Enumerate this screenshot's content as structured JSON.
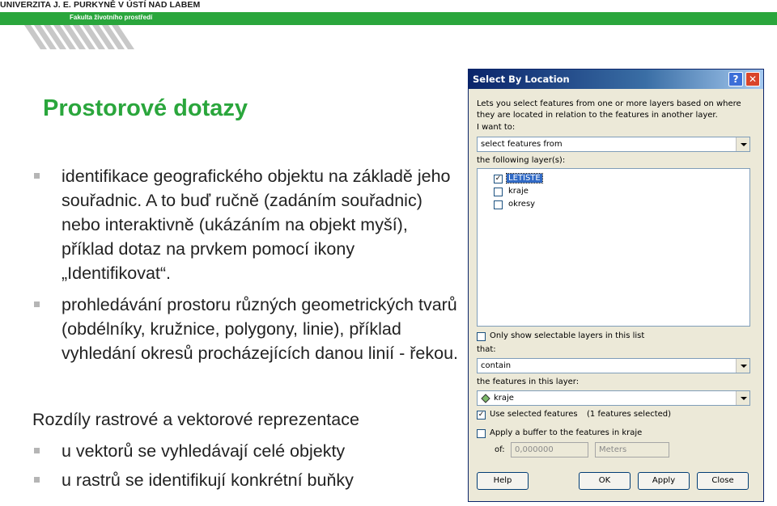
{
  "header": {
    "university": "UNIVERZITA J. E. PURKYNĚ V ÚSTÍ NAD LABEM",
    "faculty": "Fakulta životního prostředí"
  },
  "slide": {
    "title": "Prostorové dotazy",
    "bullets": [
      "identifikace geografického objektu na základě jeho souřadnic. A to buď ručně (zadáním souřadnic) nebo interaktivně (ukázáním na objekt myší), příklad dotaz na prvkem pomocí ikony „Identifikovat“.",
      "prohledávání prostoru různých geometrických tvarů (obdélníky, kružnice, polygony, linie), příklad vyhledání okresů procházejících danou linií - řekou."
    ],
    "subheading": "Rozdíly rastrové a vektorové reprezentace",
    "sub_bullets": [
      "u vektorů se vyhledávají celé objekty",
      "u rastrů se identifikují konkrétní buňky"
    ]
  },
  "dialog": {
    "title": "Select By Location",
    "help_glyph": "?",
    "close_glyph": "✕",
    "description": "Lets you select features from one or more layers based on where they are located in relation to the features in another layer.",
    "i_want_to_label": "I want to:",
    "i_want_to_value": "select features from",
    "following_layers_label": "the following layer(s):",
    "layers": [
      {
        "name": "LETISTE",
        "checked": true,
        "selected": true
      },
      {
        "name": "kraje",
        "checked": false,
        "selected": false
      },
      {
        "name": "okresy",
        "checked": false,
        "selected": false
      }
    ],
    "check_glyph": "✓",
    "only_selectable_label": "Only show selectable layers in this list",
    "that_label": "that:",
    "that_value": "contain",
    "features_layer_label": "the features in this layer:",
    "features_layer_value": "kraje",
    "use_selected_label": "Use selected features",
    "selected_count": "(1 features selected)",
    "buffer_label": "Apply a buffer to the features in kraje",
    "of_label": "of:",
    "buffer_value": "0,000000",
    "buffer_units": "Meters",
    "buttons": {
      "help": "Help",
      "ok": "OK",
      "apply": "Apply",
      "close": "Close"
    }
  },
  "colors": {
    "accent_green": "#2aa63c",
    "dialog_face": "#ece9d8",
    "titlebar_blue": "#0a246a",
    "selection_blue": "#316ac5"
  }
}
